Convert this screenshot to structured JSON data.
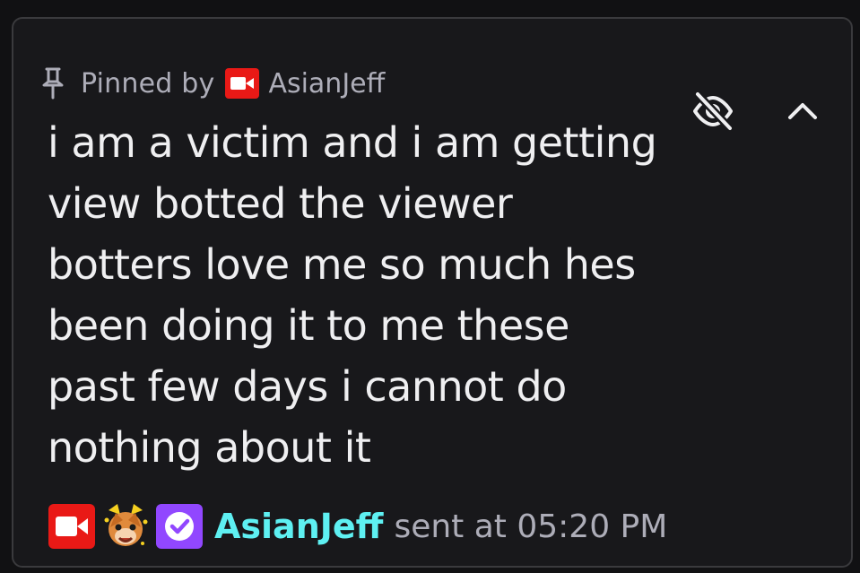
{
  "pin": {
    "prefix": "Pinned by",
    "username": "AsianJeff"
  },
  "message": {
    "text": "i am a victim and i am getting view botted the viewer botters love me so much hes been doing it to me these past few days i cannot do nothing about it"
  },
  "footer": {
    "username": "AsianJeff",
    "sent_label": "sent at 05:20 PM"
  },
  "icons": {
    "pin": "pin-icon",
    "broadcaster_badge": "broadcaster-camera-icon",
    "emote_badge": "cat-emote-icon",
    "verified_badge": "verified-check-icon",
    "hide": "eye-slash-icon",
    "collapse": "chevron-up-icon"
  },
  "colors": {
    "background": "#18181b",
    "border": "#3a3a3d",
    "text_primary": "#efeff1",
    "text_secondary": "#adadb8",
    "username": "#5ef0f2",
    "broadcaster_red": "#e91916",
    "verified_purple": "#9147ff"
  }
}
